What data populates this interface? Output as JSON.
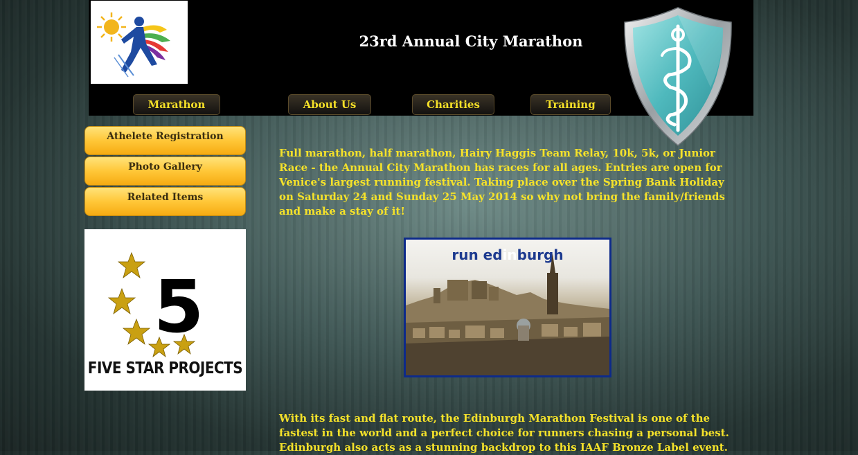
{
  "header": {
    "title": "23rd Annual City Marathon"
  },
  "nav": {
    "items": [
      "Marathon",
      "About Us",
      "Charities",
      "Training"
    ]
  },
  "sidebar": {
    "items": [
      "Athelete Registration",
      "Photo Gallery",
      "Related Items"
    ]
  },
  "sponsor": {
    "number": "5",
    "name": "FIVE STAR PROJECTS"
  },
  "main": {
    "intro": "Full marathon, half marathon, Hairy Haggis Team Relay, 10k, 5k, or Junior Race - the Annual City Marathon has races for all ages. Entries are open for Venice's largest running festival. Taking place over the Spring Bank Holiday on Saturday 24 and Sunday 25 May 2014 so why not bring the family/friends and make a stay of it!",
    "photo_title": {
      "part1": "run ed",
      "part2": "in",
      "part3": "burgh"
    },
    "second": "With its fast and flat route, the Edinburgh Marathon Festival is one of the fastest in the world and a perfect choice for runners chasing a personal best. Edinburgh also acts as a stunning backdrop to this IAAF Bronze Label event."
  },
  "colors": {
    "header_bg": "#000000",
    "nav_text": "#f5e028",
    "body_text": "#f5e22a",
    "side_button": "#ffc738",
    "shield": "#5fc3c3"
  }
}
